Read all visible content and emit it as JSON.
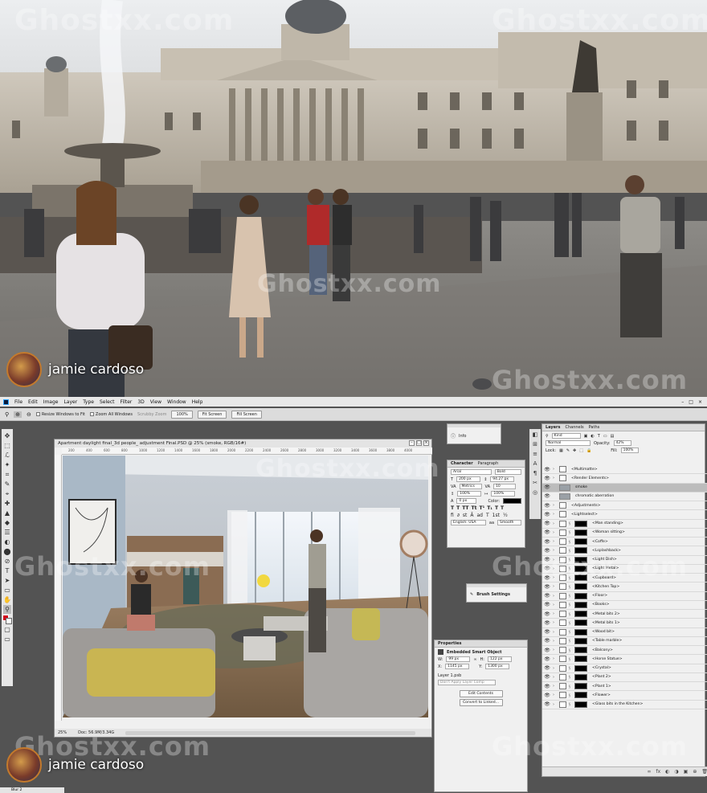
{
  "watermark": "Ghostxx.com",
  "presenter": {
    "name": "jamie cardoso"
  },
  "ps": {
    "menu": [
      "File",
      "Edit",
      "Image",
      "Layer",
      "Type",
      "Select",
      "Filter",
      "3D",
      "View",
      "Window",
      "Help"
    ],
    "window_buttons": [
      "–",
      "□",
      "×"
    ],
    "options": {
      "resize_windows": "Resize Windows to Fit",
      "zoom_all": "Zoom All Windows",
      "scrubby_zoom": "Scrubby Zoom",
      "zoom_100": "100%",
      "fit_screen": "Fit Screen",
      "fill_screen": "Fill Screen"
    },
    "tools": [
      "✥",
      "⬚",
      "ℒ",
      "✦",
      "⌗",
      "✎",
      "⌖",
      "✚",
      "▲",
      "◆",
      "☰",
      "◐",
      "⬤",
      "⊘",
      "T",
      "➤",
      "▭",
      "✋",
      "⚲"
    ],
    "document": {
      "title": "Apartment daylight final_3d people_ adjustment Final.PSD @ 25% (smoke, RGB/16#)",
      "window_buttons": [
        "–",
        "□",
        "×"
      ],
      "zoom": "25%",
      "doc_info": "Doc: 56.9M/3.34G",
      "ruler": [
        "200",
        "400",
        "600",
        "800",
        "1000",
        "1200",
        "1400",
        "1600",
        "1800",
        "2000",
        "2200",
        "2400",
        "2600",
        "2800",
        "3000",
        "3200",
        "3400",
        "3600",
        "3800",
        "4000"
      ]
    },
    "info_panel": {
      "title": "Info"
    },
    "character": {
      "tabs": [
        "Character",
        "Paragraph"
      ],
      "font_family": "Arial",
      "font_style": "Bold",
      "font_size": "200 px",
      "leading": "94.27 px",
      "kerning": "Metrics",
      "tracking": "10",
      "vertical_scale": "100%",
      "horizontal_scale": "100%",
      "baseline": "0 px",
      "color_label": "Color:",
      "language": "English: USA",
      "antialias": "Smooth",
      "styles": [
        "T",
        "T",
        "TT",
        "Tt",
        "T¹",
        "T₁",
        "T",
        "T"
      ]
    },
    "brush_settings": {
      "title": "Brush Settings"
    },
    "properties": {
      "title": "Properties",
      "type": "Embedded Smart Object",
      "w_label": "W:",
      "w": "99 px",
      "h_label": "H:",
      "h": "122 px",
      "x_label": "X:",
      "x": "1145 px",
      "y_label": "Y:",
      "y": "1300 px",
      "layer_label": "Layer 1.psb",
      "comp": "Don't Apply Layer Comp",
      "edit_contents": "Edit Contents",
      "convert": "Convert to Linked..."
    },
    "layers": {
      "tabs": [
        "Layers",
        "Channels",
        "Paths"
      ],
      "kind": "Kind",
      "blend": "Normal",
      "opacity_label": "Opacity:",
      "opacity": "42%",
      "lock_label": "Lock:",
      "fill_label": "Fill:",
      "fill": "100%",
      "items": [
        {
          "name": "<Multimatte>",
          "type": "folder"
        },
        {
          "name": "<Render Elements>",
          "type": "folder"
        },
        {
          "name": "smoke",
          "type": "smart",
          "selected": true
        },
        {
          "name": "chromatic aberration",
          "type": "image"
        },
        {
          "name": "<Adjustments>",
          "type": "folder"
        },
        {
          "name": "<Lightselect>",
          "type": "folder"
        },
        {
          "name": "<Man standing>",
          "type": "mask"
        },
        {
          "name": "<Woman sitting>",
          "type": "mask"
        },
        {
          "name": "<Coffe>",
          "type": "mask"
        },
        {
          "name": "<Lsplashback>",
          "type": "mask"
        },
        {
          "name": "<Light Dish>",
          "type": "mask"
        },
        {
          "name": "<Light Metal>",
          "type": "mask"
        },
        {
          "name": "<Cupboard>",
          "type": "mask"
        },
        {
          "name": "<Kitchen Top>",
          "type": "mask"
        },
        {
          "name": "<Floor>",
          "type": "mask"
        },
        {
          "name": "<Books>",
          "type": "mask"
        },
        {
          "name": "<Metal bits 2>",
          "type": "mask"
        },
        {
          "name": "<Metal bits 1>",
          "type": "mask"
        },
        {
          "name": "<Wood bit>",
          "type": "mask"
        },
        {
          "name": "<Table marble>",
          "type": "mask"
        },
        {
          "name": "<Balcony>",
          "type": "mask"
        },
        {
          "name": "<Horse Statue>",
          "type": "mask"
        },
        {
          "name": "<Crystal>",
          "type": "mask"
        },
        {
          "name": "<Plant 2>",
          "type": "mask"
        },
        {
          "name": "<Plant 1>",
          "type": "mask"
        },
        {
          "name": "<Flower>",
          "type": "mask"
        },
        {
          "name": "<Glass bits in the Kitchen>",
          "type": "mask"
        }
      ],
      "footer_icons": [
        "∞",
        "fx",
        "◐",
        "◑",
        "▣",
        "⊕",
        "🗑"
      ]
    },
    "right_strip": [
      "◧",
      "⊞",
      "≡",
      "A",
      "¶",
      "✂",
      "◎"
    ],
    "bottom_tab": "Blur 2"
  },
  "colors": {
    "ps_bg": "#535353",
    "panel": "#f0f0f0",
    "accent": "#31a8ff",
    "foreground": "#d0021b"
  }
}
